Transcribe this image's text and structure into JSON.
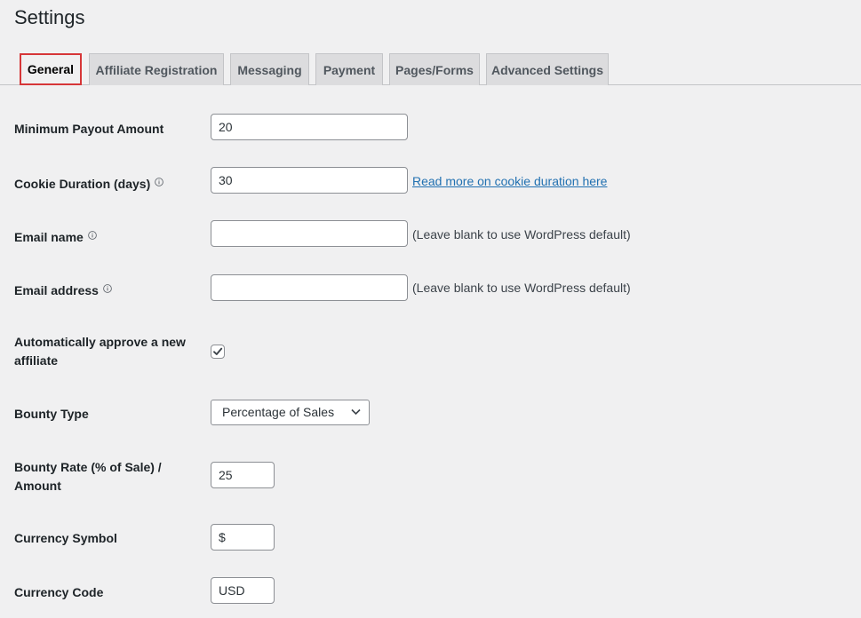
{
  "page": {
    "title": "Settings"
  },
  "tabs": [
    {
      "label": "General",
      "active": true
    },
    {
      "label": "Affiliate Registration",
      "active": false
    },
    {
      "label": "Messaging",
      "active": false
    },
    {
      "label": "Payment",
      "active": false
    },
    {
      "label": "Pages/Forms",
      "active": false
    },
    {
      "label": "Advanced Settings",
      "active": false
    }
  ],
  "fields": {
    "min_payout": {
      "label": "Minimum Payout Amount",
      "value": "20"
    },
    "cookie_duration": {
      "label": "Cookie Duration (days)",
      "value": "30",
      "link": "Read more on cookie duration here"
    },
    "email_name": {
      "label": "Email name",
      "value": "",
      "note": "(Leave blank to use WordPress default)"
    },
    "email_address": {
      "label": "Email address",
      "value": "",
      "note": "(Leave blank to use WordPress default)"
    },
    "auto_approve": {
      "label_line1": "Automatically approve a new",
      "label_line2": "affiliate",
      "checked": true
    },
    "bounty_type": {
      "label": "Bounty Type",
      "selected": "Percentage of Sales"
    },
    "bounty_rate": {
      "label_line1": "Bounty Rate (% of Sale) /",
      "label_line2": "Amount",
      "value": "25"
    },
    "currency_symbol": {
      "label": "Currency Symbol",
      "value": "$"
    },
    "currency_code": {
      "label": "Currency Code",
      "value": "USD"
    }
  },
  "colors": {
    "background": "#f0f0f1",
    "link": "#2271b1",
    "active_tab_border": "#d63638"
  }
}
